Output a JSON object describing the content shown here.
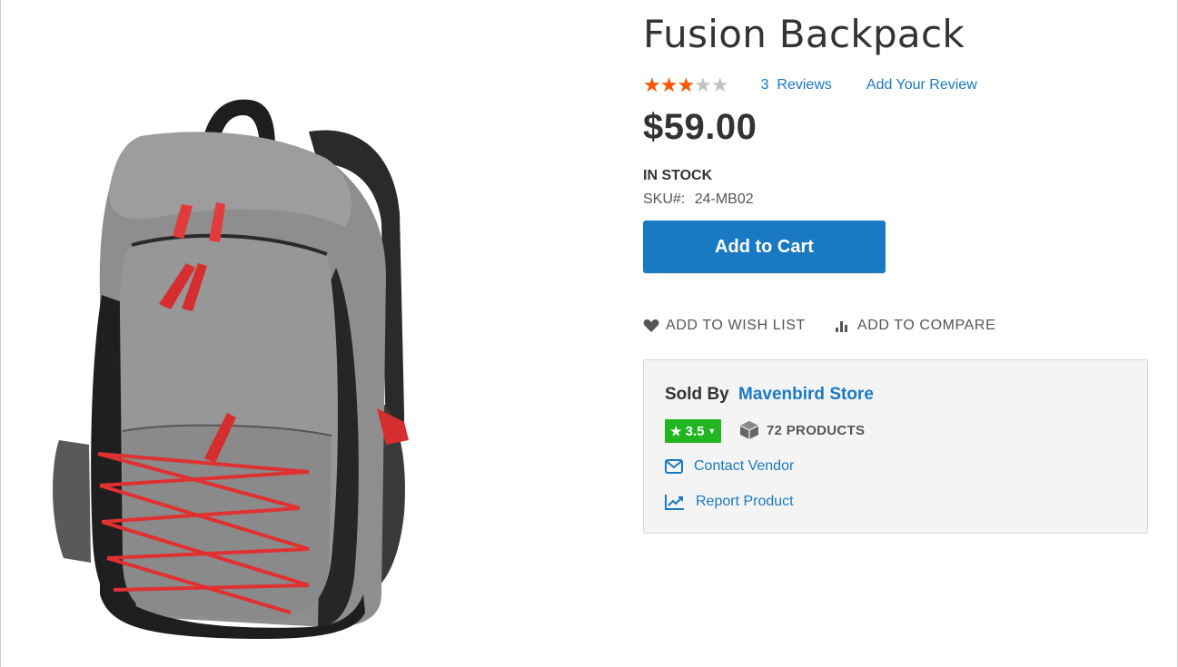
{
  "product": {
    "title": "Fusion Backpack",
    "rating": {
      "stars_glyphs": "★★★★★",
      "value_fraction": 0.6
    },
    "reviews_count": "3",
    "reviews_label": "Reviews",
    "add_review_label": "Add Your Review",
    "price": "$59.00",
    "stock_status": "IN STOCK",
    "sku_label": "SKU#:",
    "sku_value": "24-MB02",
    "add_to_cart_label": "Add to Cart",
    "image_icon": "backpack-image"
  },
  "actions": {
    "wishlist_label": "ADD TO WISH LIST",
    "wishlist_icon": "heart-icon",
    "compare_label": "ADD TO COMPARE",
    "compare_icon": "bar-chart-icon"
  },
  "vendor": {
    "sold_by_label": "Sold By",
    "store_name": "Mavenbird Store",
    "rating_value": "3.5",
    "products_count_label": "72 PRODUCTS",
    "contact_label": "Contact Vendor",
    "report_label": "Report Product"
  },
  "colors": {
    "accent": "#1979c3",
    "star": "#ff5501",
    "badge": "#22b522",
    "text": "#333333"
  }
}
